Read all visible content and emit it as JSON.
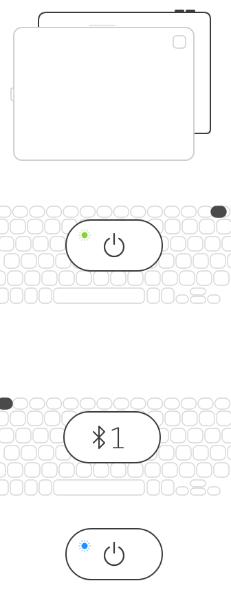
{
  "ui": {
    "title": "",
    "bluetooth_channel_label": "1",
    "colors": {
      "outline": "#cfcfcf",
      "stroke_dark": "#3b3b3b",
      "indicator_green": "#8bd13f",
      "indicator_blue": "#1e90ff",
      "key_fill": "#ffffff",
      "key_stroke": "#d6d6d6",
      "dark_key": "#4a4a4a"
    },
    "icons": {
      "tablet": "tablet-illustration-icon",
      "keyboard": "keyboard-illustration-icon",
      "power": "power-icon",
      "bluetooth": "bluetooth-icon"
    }
  }
}
